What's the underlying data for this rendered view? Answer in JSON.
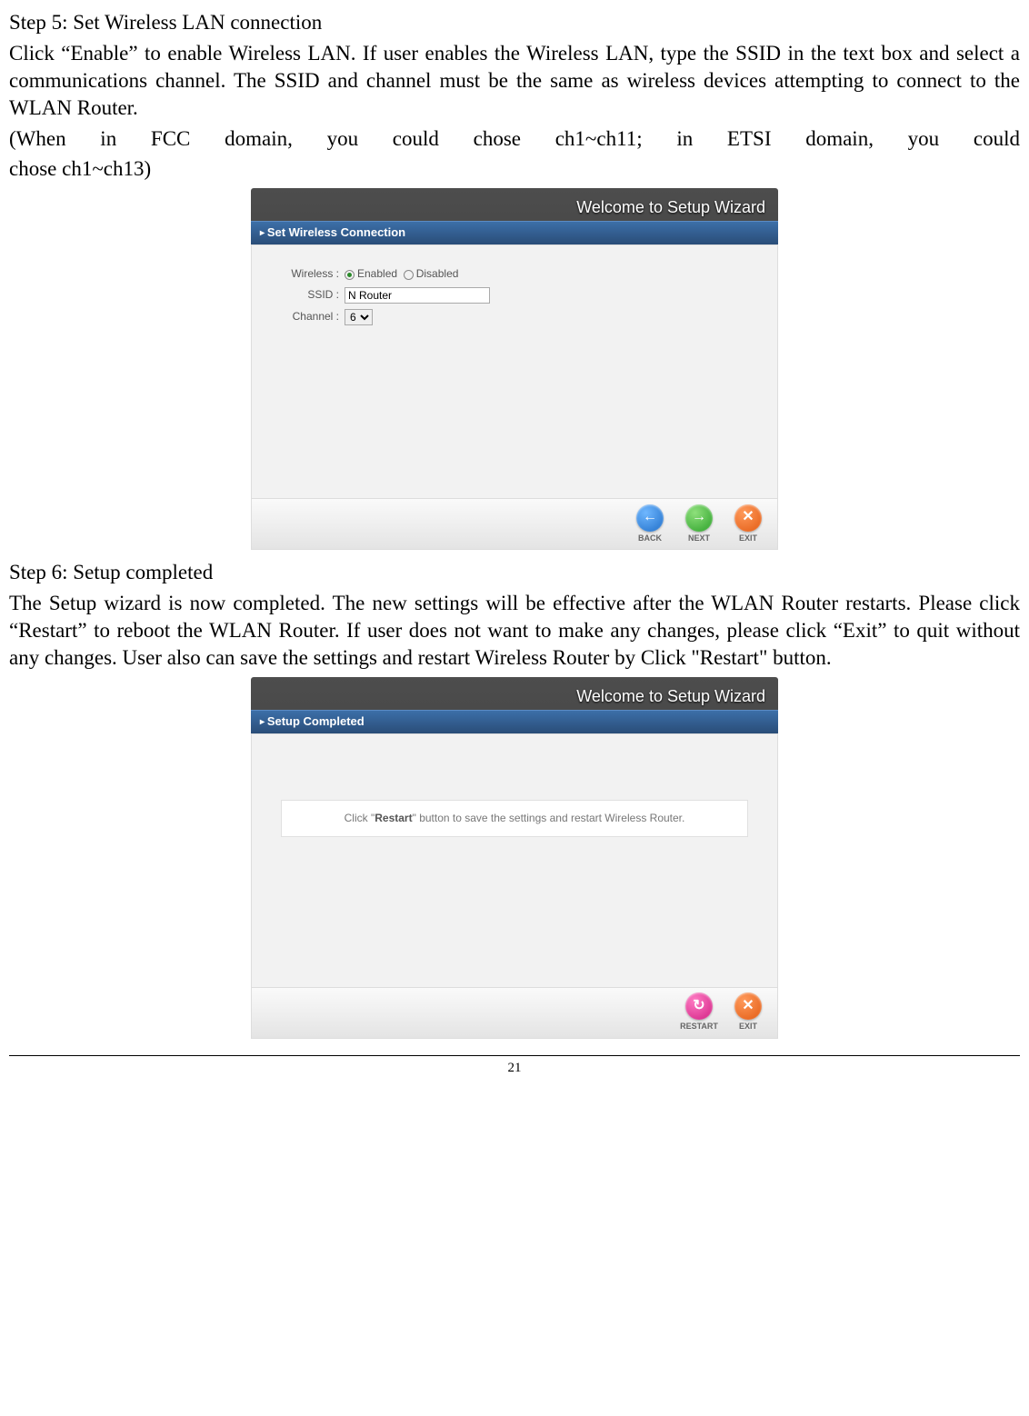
{
  "step5": {
    "title": "Step 5: Set Wireless LAN connection",
    "para1": "Click “Enable” to enable Wireless LAN. If user enables the Wireless LAN, type the SSID in the text box and select a communications channel. The SSID and channel must be the same as wireless devices attempting to connect to the WLAN Router.",
    "para2a": "(When in FCC domain, you could chose ch1~ch11; in ETSI domain, you could",
    "para2b": "chose ch1~ch13)"
  },
  "wizard1": {
    "header": "Welcome to Setup Wizard",
    "section": "Set Wireless Connection",
    "labels": {
      "wireless": "Wireless :",
      "ssid": "SSID :",
      "channel": "Channel :"
    },
    "options": {
      "enabled": "Enabled",
      "disabled": "Disabled"
    },
    "values": {
      "wireless_selected": "enabled",
      "ssid": "N Router",
      "channel": "6"
    },
    "buttons": {
      "back": "BACK",
      "next": "NEXT",
      "exit": "EXIT"
    }
  },
  "step6": {
    "title": "Step 6: Setup completed",
    "para": "The Setup wizard is now completed. The new settings will be effective after the WLAN Router restarts. Please click “Restart” to reboot the WLAN Router. If user does not want to make any changes, please click “Exit” to quit without any changes. User also can save the settings and restart Wireless Router by Click \"Restart\" button."
  },
  "wizard2": {
    "header": "Welcome to Setup Wizard",
    "section": "Setup Completed",
    "msg_prefix": "Click \"",
    "msg_bold": "Restart",
    "msg_suffix": "\" button to save the settings and restart Wireless Router.",
    "buttons": {
      "restart": "RESTART",
      "exit": "EXIT"
    }
  },
  "page_number": "21",
  "icons": {
    "back": "←",
    "next": "→",
    "exit": "✕",
    "restart": "↻"
  }
}
